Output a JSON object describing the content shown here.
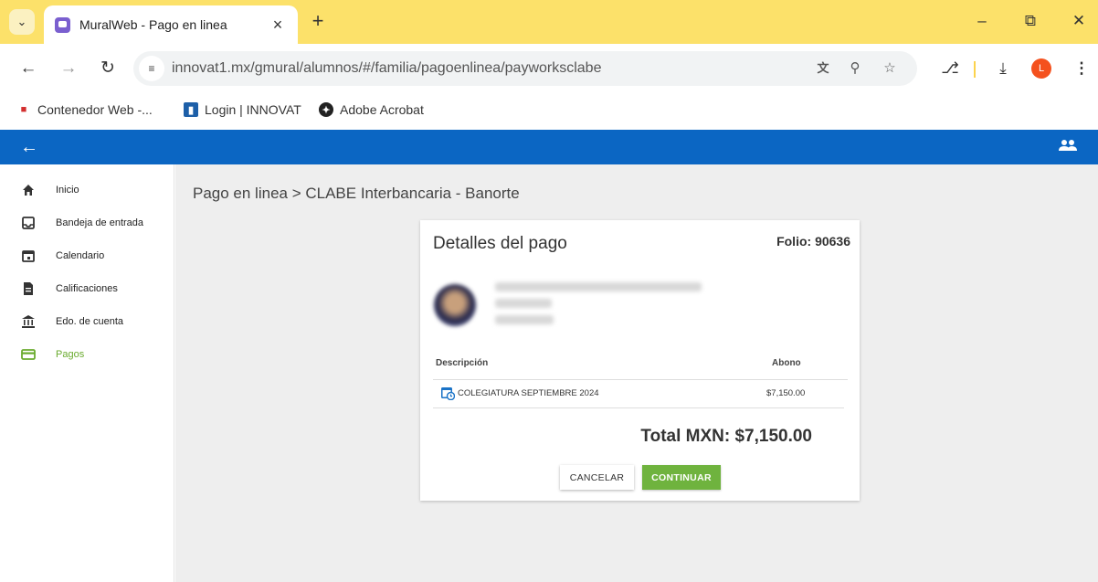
{
  "browser": {
    "tab_title": "MuralWeb - Pago en linea",
    "url": "innovat1.mx/gmural/alumnos/#/familia/pagoenlinea/payworksclabe",
    "profile_initial": "L",
    "bookmarks": [
      {
        "label": "Contenedor Web -..."
      },
      {
        "label": "Login | INNOVAT"
      },
      {
        "label": "Adobe Acrobat"
      }
    ]
  },
  "sidebar": {
    "items": [
      {
        "label": "Inicio",
        "icon": "home-icon"
      },
      {
        "label": "Bandeja de entrada",
        "icon": "inbox-icon"
      },
      {
        "label": "Calendario",
        "icon": "calendar-icon"
      },
      {
        "label": "Calificaciones",
        "icon": "document-icon"
      },
      {
        "label": "Edo. de cuenta",
        "icon": "bank-icon"
      },
      {
        "label": "Pagos",
        "icon": "credit-card-icon",
        "active": true
      }
    ]
  },
  "main": {
    "breadcrumb": "Pago en linea > CLABE Interbancaria - Banorte",
    "card": {
      "title": "Detalles del pago",
      "folio": "Folio: 90636",
      "table": {
        "headers": {
          "description": "Descripción",
          "amount": "Abono"
        },
        "rows": [
          {
            "description": "COLEGIATURA SEPTIEMBRE 2024",
            "amount": "$7,150.00"
          }
        ]
      },
      "total": "Total MXN: $7,150.00",
      "cancel_label": "CANCELAR",
      "continue_label": "CONTINUAR"
    }
  },
  "colors": {
    "tabstrip": "#fce16a",
    "appbar": "#0b66c3",
    "accent_green": "#6fb33e"
  }
}
